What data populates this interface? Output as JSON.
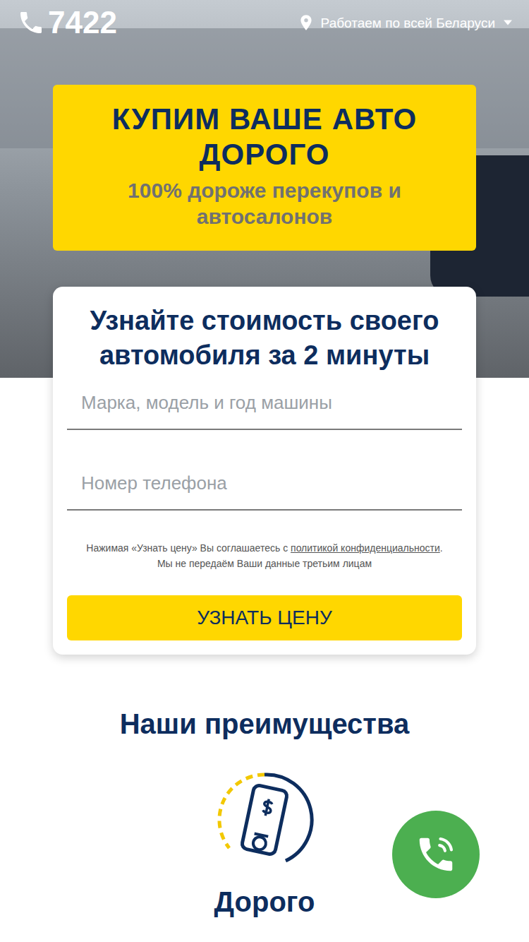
{
  "header": {
    "phone": "7422",
    "region": "Работаем по всей Беларуси"
  },
  "hero": {
    "title": "КУПИМ ВАШЕ АВТО ДОРОГО",
    "subtitle": "100% дороже перекупов и автосалонов"
  },
  "form": {
    "title": "Узнайте стоимость своего автомобиля за 2 минуты",
    "fields": [
      {
        "placeholder": "Марка, модель и год машины"
      },
      {
        "placeholder": "Номер телефона"
      }
    ],
    "consent": {
      "before": "Нажимая «Узнать цену» Вы соглашаетесь с ",
      "link": "политикой конфиденциальности",
      "after": ".",
      "note": "Мы не передаём Ваши данные третьим лицам"
    },
    "button": "УЗНАТЬ ЦЕНУ"
  },
  "advantages": {
    "title": "Наши преимущества",
    "items": [
      {
        "label": "Дорого"
      }
    ]
  }
}
